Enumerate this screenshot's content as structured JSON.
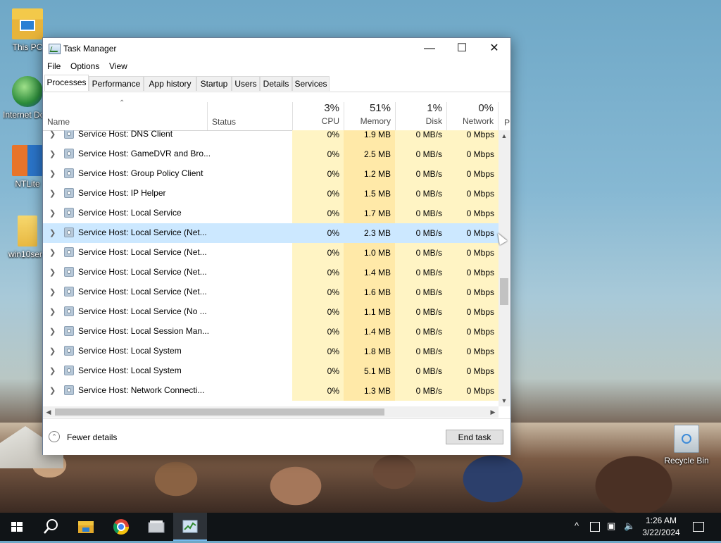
{
  "desktop": {
    "icons": [
      {
        "label": "This PC"
      },
      {
        "label": "Internet Downlo..."
      },
      {
        "label": "NTLite"
      },
      {
        "label": "win10serv"
      },
      {
        "label": "Recycle Bin"
      }
    ]
  },
  "window": {
    "title": "Task Manager",
    "controls": {
      "minimize": "—",
      "maximize": "☐",
      "close": "✕"
    },
    "menu": [
      "File",
      "Options",
      "View"
    ],
    "tabs": [
      "Processes",
      "Performance",
      "App history",
      "Startup",
      "Users",
      "Details",
      "Services"
    ],
    "active_tab": "Processes",
    "columns": {
      "name": "Name",
      "status": "Status",
      "cpu": {
        "pct": "3%",
        "label": "CPU"
      },
      "memory": {
        "pct": "51%",
        "label": "Memory"
      },
      "disk": {
        "pct": "1%",
        "label": "Disk"
      },
      "network": {
        "pct": "0%",
        "label": "Network"
      },
      "next": "P"
    },
    "rows": [
      {
        "name": "Service Host: DNS Client",
        "cpu": "0%",
        "mem": "1.9 MB",
        "disk": "0 MB/s",
        "net": "0 Mbps"
      },
      {
        "name": "Service Host: GameDVR and Bro...",
        "cpu": "0%",
        "mem": "2.5 MB",
        "disk": "0 MB/s",
        "net": "0 Mbps"
      },
      {
        "name": "Service Host: Group Policy Client",
        "cpu": "0%",
        "mem": "1.2 MB",
        "disk": "0 MB/s",
        "net": "0 Mbps"
      },
      {
        "name": "Service Host: IP Helper",
        "cpu": "0%",
        "mem": "1.5 MB",
        "disk": "0 MB/s",
        "net": "0 Mbps"
      },
      {
        "name": "Service Host: Local Service",
        "cpu": "0%",
        "mem": "1.7 MB",
        "disk": "0 MB/s",
        "net": "0 Mbps"
      },
      {
        "name": "Service Host: Local Service (Net...",
        "cpu": "0%",
        "mem": "2.3 MB",
        "disk": "0 MB/s",
        "net": "0 Mbps"
      },
      {
        "name": "Service Host: Local Service (Net...",
        "cpu": "0%",
        "mem": "1.0 MB",
        "disk": "0 MB/s",
        "net": "0 Mbps"
      },
      {
        "name": "Service Host: Local Service (Net...",
        "cpu": "0%",
        "mem": "1.4 MB",
        "disk": "0 MB/s",
        "net": "0 Mbps"
      },
      {
        "name": "Service Host: Local Service (Net...",
        "cpu": "0%",
        "mem": "1.6 MB",
        "disk": "0 MB/s",
        "net": "0 Mbps"
      },
      {
        "name": "Service Host: Local Service (No ...",
        "cpu": "0%",
        "mem": "1.1 MB",
        "disk": "0 MB/s",
        "net": "0 Mbps"
      },
      {
        "name": "Service Host: Local Session Man...",
        "cpu": "0%",
        "mem": "1.4 MB",
        "disk": "0 MB/s",
        "net": "0 Mbps"
      },
      {
        "name": "Service Host: Local System",
        "cpu": "0%",
        "mem": "1.8 MB",
        "disk": "0 MB/s",
        "net": "0 Mbps"
      },
      {
        "name": "Service Host: Local System",
        "cpu": "0%",
        "mem": "5.1 MB",
        "disk": "0 MB/s",
        "net": "0 Mbps"
      },
      {
        "name": "Service Host: Network Connecti...",
        "cpu": "0%",
        "mem": "1.3 MB",
        "disk": "0 MB/s",
        "net": "0 Mbps"
      }
    ],
    "footer": {
      "fewer_details": "Fewer details",
      "end_task": "End task"
    }
  },
  "taskbar": {
    "clock_time": "1:26 AM",
    "clock_date": "3/22/2024",
    "tray_chevron": "^"
  }
}
